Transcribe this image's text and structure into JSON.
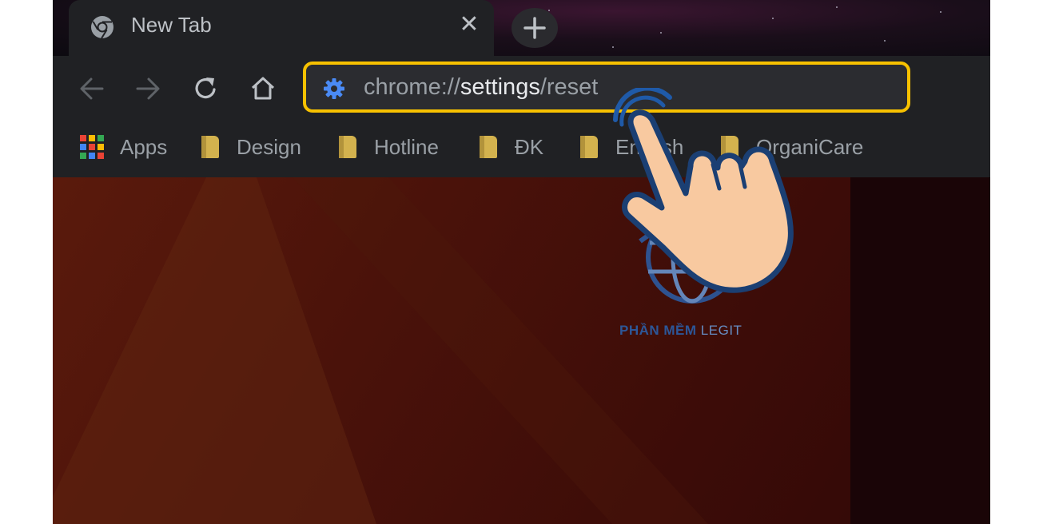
{
  "tab": {
    "title": "New Tab",
    "close_glyph": "✕",
    "new_tab_glyph": "+"
  },
  "toolbar": {
    "back_icon": "back-arrow-icon",
    "forward_icon": "forward-arrow-icon",
    "reload_icon": "reload-icon",
    "home_icon": "home-icon"
  },
  "omnibox": {
    "icon": "settings-gear-icon",
    "url_prefix": "chrome://",
    "url_highlight": "settings",
    "url_suffix": "/reset",
    "highlight_color": "#f7c100"
  },
  "bookmarks": {
    "items": [
      {
        "label": "Apps"
      },
      {
        "label": "Design"
      },
      {
        "label": "Hotline"
      },
      {
        "label": "ĐK"
      },
      {
        "label": "English"
      },
      {
        "label": "OrganiCare"
      }
    ]
  },
  "watermark": {
    "text_bold": "PHẦN MỀM",
    "text_light": "LEGIT"
  }
}
